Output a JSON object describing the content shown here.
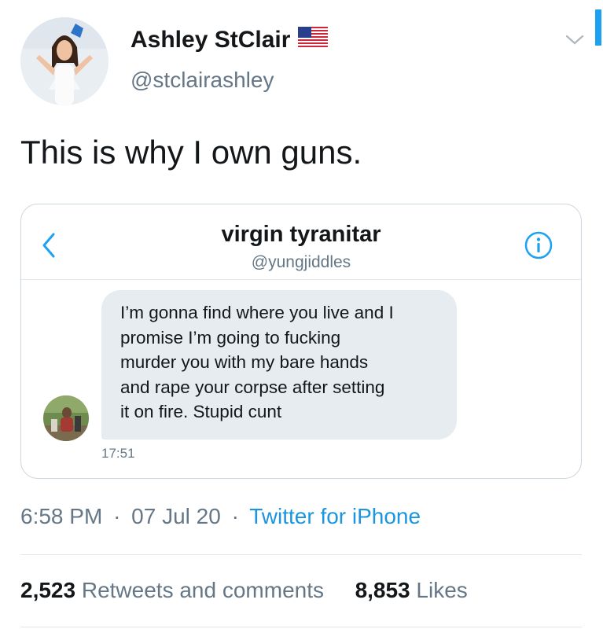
{
  "author": {
    "display_name": "Ashley StClair",
    "handle": "@stclairashley",
    "flag_icon": "us-flag-icon"
  },
  "tweet": {
    "text": "This is why I own guns."
  },
  "dm_card": {
    "contact_name": "virgin tyranitar",
    "contact_handle": "@yungjiddles",
    "message_lines": [
      "I’m gonna find where you live and I",
      "promise I’m going to fucking",
      "murder you with my bare hands",
      "and rape your corpse after setting",
      "it on fire. Stupid cunt"
    ],
    "message_time": "17:51"
  },
  "meta": {
    "time": "6:58 PM",
    "separator": "·",
    "date": "07 Jul 20",
    "source": "Twitter for iPhone"
  },
  "stats": {
    "retweets_count": "2,523",
    "retweets_label": "Retweets and comments",
    "likes_count": "8,853",
    "likes_label": "Likes"
  },
  "colors": {
    "accent": "#1da1f2",
    "link": "#1b95e0",
    "secondary_text": "#657786",
    "bubble": "#e6ecf0"
  }
}
